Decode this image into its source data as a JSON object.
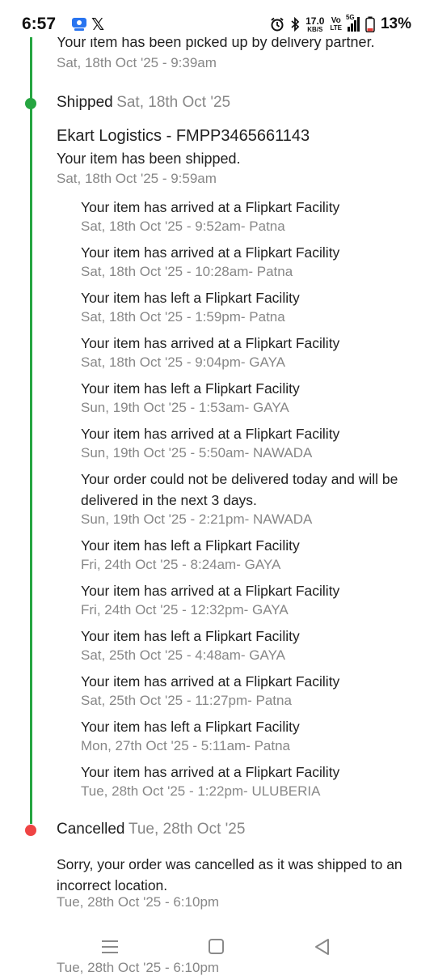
{
  "status_bar": {
    "time": "6:57",
    "x_logo": "𝕏",
    "net_speed_value": "17.0",
    "net_speed_unit": "KB/S",
    "volte_top": "Vo",
    "volte_bottom": "LTE",
    "network": "5G",
    "battery": "13%",
    "icons": [
      "app-notification-icon",
      "x-logo-icon",
      "alarm-icon",
      "bluetooth-icon",
      "signal-icon",
      "battery-icon"
    ]
  },
  "previous_event": {
    "message": "Your item has been picked up by delivery partner.",
    "date": "Sat, 18th Oct '25 - 9:39am"
  },
  "shipped": {
    "title": "Shipped",
    "date": "Sat, 18th Oct '25",
    "courier": "Ekart Logistics - FMPP3465661143",
    "message": "Your item has been shipped.",
    "timestamp": "Sat, 18th Oct '25 - 9:59am",
    "updates": [
      {
        "message": "Your item has arrived at a Flipkart Facility",
        "date": "Sat, 18th Oct '25 - 9:52am- Patna"
      },
      {
        "message": "Your item has arrived at a Flipkart Facility",
        "date": "Sat, 18th Oct '25 - 10:28am- Patna"
      },
      {
        "message": "Your item has left a Flipkart Facility",
        "date": "Sat, 18th Oct '25 - 1:59pm- Patna"
      },
      {
        "message": "Your item has arrived at a Flipkart Facility",
        "date": "Sat, 18th Oct '25 - 9:04pm- GAYA"
      },
      {
        "message": "Your item has left a Flipkart Facility",
        "date": "Sun, 19th Oct '25 - 1:53am- GAYA"
      },
      {
        "message": "Your item has arrived at a Flipkart Facility",
        "date": "Sun, 19th Oct '25 - 5:50am- NAWADA"
      },
      {
        "message": "Your order could not be delivered today and will be delivered in the next 3 days.",
        "date": "Sun, 19th Oct '25 - 2:21pm- NAWADA"
      },
      {
        "message": "Your item has left a Flipkart Facility",
        "date": "Fri, 24th Oct '25 - 8:24am- GAYA"
      },
      {
        "message": "Your item has arrived at a Flipkart Facility",
        "date": "Fri, 24th Oct '25 - 12:32pm- GAYA"
      },
      {
        "message": "Your item has left a Flipkart Facility",
        "date": "Sat, 25th Oct '25 - 4:48am- GAYA"
      },
      {
        "message": "Your item has arrived at a Flipkart Facility",
        "date": "Sat, 25th Oct '25 - 11:27pm- Patna"
      },
      {
        "message": "Your item has left a Flipkart Facility",
        "date": "Mon, 27th Oct '25 - 5:11am- Patna"
      },
      {
        "message": "Your item has arrived at a Flipkart Facility",
        "date": "Tue, 28th Oct '25 - 1:22pm- ULUBERIA"
      }
    ]
  },
  "cancelled": {
    "title": "Cancelled",
    "date": "Tue, 28th Oct '25",
    "message": "Sorry, your order was cancelled as it was shipped to an incorrect location.",
    "timestamp": "Tue, 28th Oct '25 - 6:10pm"
  },
  "colors": {
    "timeline_green": "#26a541",
    "cancel_red": "#ef4444",
    "secondary_text": "#878787",
    "primary_text": "#212121"
  },
  "nav_bar": {
    "buttons": [
      "recents-menu-icon",
      "home-square-icon",
      "back-triangle-icon"
    ],
    "behind_text": "Tue, 28th Oct '25 - 6:10pm"
  }
}
